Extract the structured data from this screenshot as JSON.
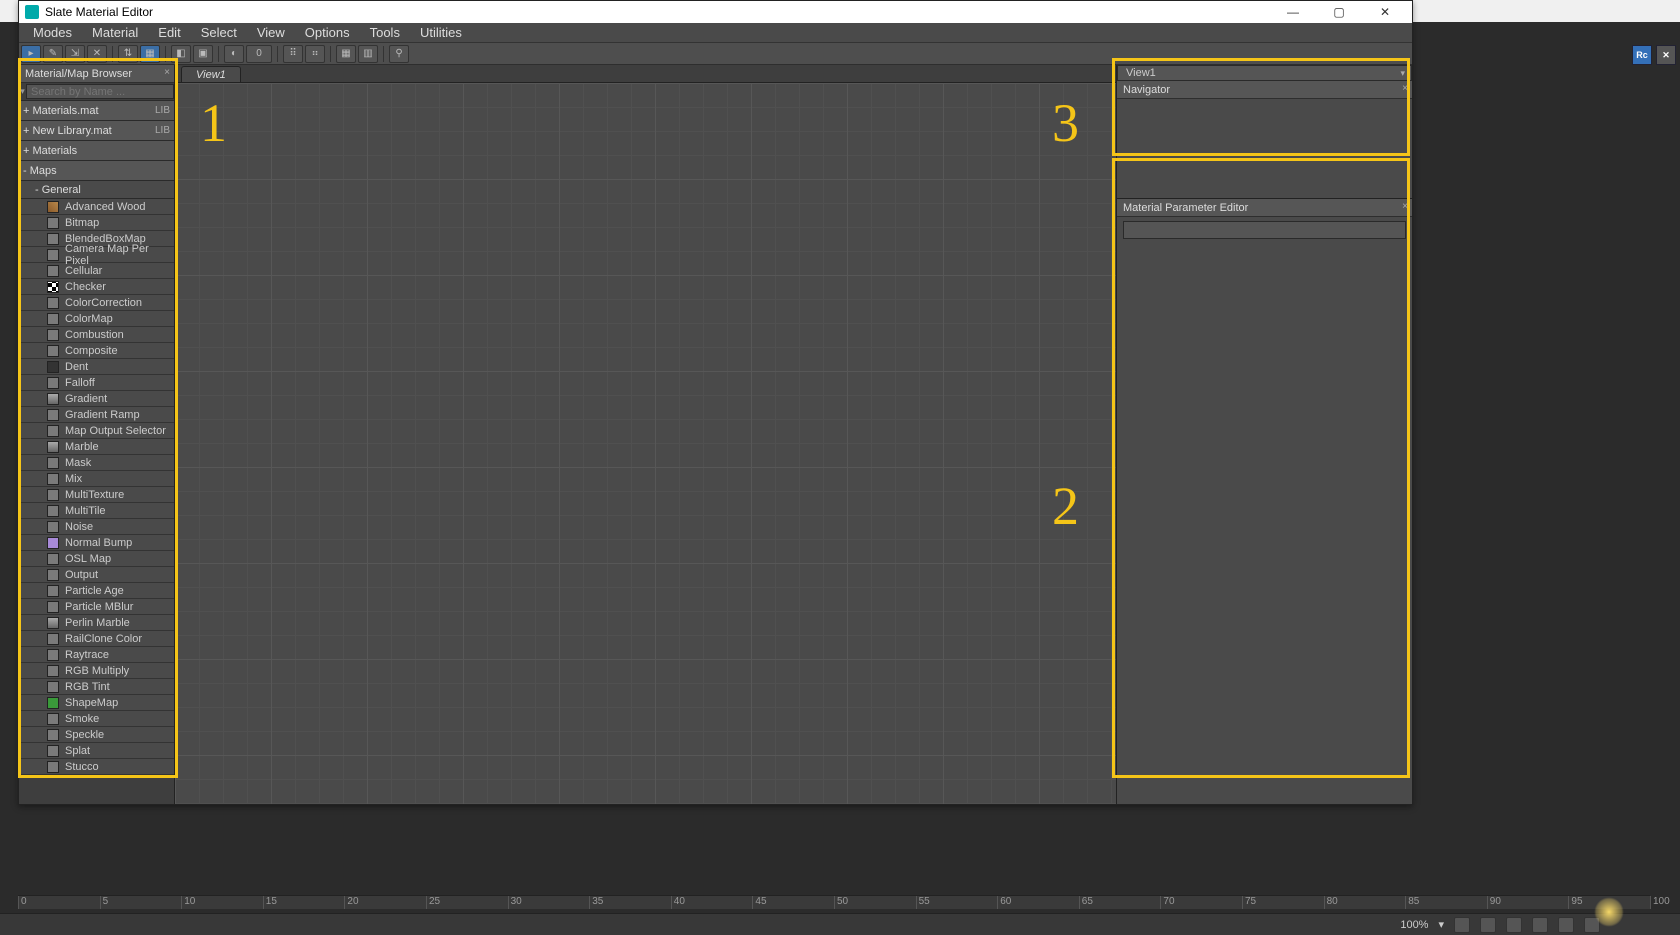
{
  "window": {
    "title": "Slate Material Editor",
    "min_label": "—",
    "max_label": "▢",
    "close_label": "✕"
  },
  "menus": [
    "Modes",
    "Material",
    "Edit",
    "Select",
    "View",
    "Options",
    "Tools",
    "Utilities"
  ],
  "toolbar": {
    "zero_label": "0"
  },
  "browser": {
    "title": "Material/Map Browser",
    "search_placeholder": "Search by Name ...",
    "groups": [
      {
        "label": "+ Materials.mat",
        "lib": "LIB"
      },
      {
        "label": "+ New Library.mat",
        "lib": "LIB"
      },
      {
        "label": "+ Materials",
        "lib": ""
      }
    ],
    "maps_hdr": "- Maps",
    "general_hdr": "- General",
    "items": [
      {
        "name": "Advanced Wood",
        "sw": "sw-wood"
      },
      {
        "name": "Bitmap",
        "sw": "sw-plain"
      },
      {
        "name": "BlendedBoxMap",
        "sw": "sw-plain"
      },
      {
        "name": "Camera Map Per Pixel",
        "sw": "sw-plain"
      },
      {
        "name": "Cellular",
        "sw": "sw-plain"
      },
      {
        "name": "Checker",
        "sw": "sw-check"
      },
      {
        "name": "ColorCorrection",
        "sw": "sw-plain"
      },
      {
        "name": "ColorMap",
        "sw": "sw-plain"
      },
      {
        "name": "Combustion",
        "sw": "sw-plain"
      },
      {
        "name": "Composite",
        "sw": "sw-plain"
      },
      {
        "name": "Dent",
        "sw": "sw-dark"
      },
      {
        "name": "Falloff",
        "sw": "sw-plain"
      },
      {
        "name": "Gradient",
        "sw": "sw-vr"
      },
      {
        "name": "Gradient Ramp",
        "sw": "sw-plain"
      },
      {
        "name": "Map Output Selector",
        "sw": "sw-plain"
      },
      {
        "name": "Marble",
        "sw": "sw-vr"
      },
      {
        "name": "Mask",
        "sw": "sw-plain"
      },
      {
        "name": "Mix",
        "sw": "sw-plain"
      },
      {
        "name": "MultiTexture",
        "sw": "sw-plain"
      },
      {
        "name": "MultiTile",
        "sw": "sw-plain"
      },
      {
        "name": "Noise",
        "sw": "sw-plain"
      },
      {
        "name": "Normal Bump",
        "sw": "sw-purple"
      },
      {
        "name": "OSL Map",
        "sw": "sw-plain"
      },
      {
        "name": "Output",
        "sw": "sw-plain"
      },
      {
        "name": "Particle Age",
        "sw": "sw-plain"
      },
      {
        "name": "Particle MBlur",
        "sw": "sw-plain"
      },
      {
        "name": "Perlin Marble",
        "sw": "sw-vr"
      },
      {
        "name": "RailClone Color",
        "sw": "sw-plain"
      },
      {
        "name": "Raytrace",
        "sw": "sw-plain"
      },
      {
        "name": "RGB Multiply",
        "sw": "sw-plain"
      },
      {
        "name": "RGB Tint",
        "sw": "sw-plain"
      },
      {
        "name": "ShapeMap",
        "sw": "sw-green"
      },
      {
        "name": "Smoke",
        "sw": "sw-plain"
      },
      {
        "name": "Speckle",
        "sw": "sw-plain"
      },
      {
        "name": "Splat",
        "sw": "sw-plain"
      },
      {
        "name": "Stucco",
        "sw": "sw-plain"
      }
    ]
  },
  "right": {
    "view_dropdown": "View1",
    "navigator_title": "Navigator",
    "param_title": "Material Parameter Editor"
  },
  "tabs": {
    "view1": "View1"
  },
  "annotations": {
    "a1": "1",
    "a2": "2",
    "a3": "3"
  },
  "right_icons": {
    "rc": "Rc"
  },
  "status": {
    "zoom": "100%",
    "zoom_suffix": "▾"
  },
  "timeline_ticks": [
    "0",
    "5",
    "10",
    "15",
    "20",
    "25",
    "30",
    "35",
    "40",
    "45",
    "50",
    "55",
    "60",
    "65",
    "70",
    "75",
    "80",
    "85",
    "90",
    "95",
    "100"
  ]
}
